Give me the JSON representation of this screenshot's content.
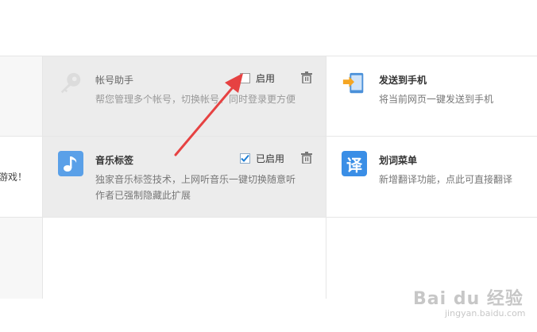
{
  "left_panel": {
    "truncated_text": "游戏！"
  },
  "extensions": [
    {
      "title": "帐号助手",
      "description": "帮您管理多个帐号，切换帐号、同时登录更方便",
      "toggle_label": "启用",
      "enabled": false,
      "icon": "key-icon"
    },
    {
      "title": "发送到手机",
      "description": "将当前网页一键发送到手机",
      "icon": "send-to-phone-icon"
    },
    {
      "title": "音乐标签",
      "description": "独家音乐标签技术，上网听音乐一键切换随意听作者已强制隐藏此扩展",
      "toggle_label": "已启用",
      "enabled": true,
      "icon": "music-note-icon"
    },
    {
      "title": "划词菜单",
      "description": "新增翻译功能，点此可直接翻译",
      "icon": "translate-icon",
      "icon_glyph": "译"
    }
  ],
  "watermark": {
    "brand": "Bai du 经验",
    "sub": "jingyan.baidu.com"
  },
  "colors": {
    "highlight_bg": "#ececec",
    "checkbox_blue": "#1e7fd6",
    "arrow_red": "#e64242",
    "music_icon_bg": "#5aa0e8",
    "translate_icon_bg": "#3a8ee6"
  }
}
